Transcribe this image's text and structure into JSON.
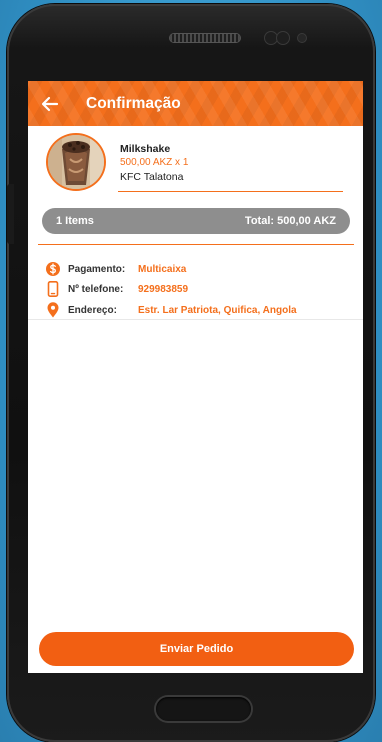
{
  "appbar": {
    "title": "Confirmação"
  },
  "product": {
    "name": "Milkshake",
    "price_qty": "500,00 AKZ x 1",
    "store": "KFC Talatona"
  },
  "summary": {
    "items": "1 Items",
    "total": "Total: 500,00 AKZ"
  },
  "info": {
    "payment_label": "Pagamento:",
    "payment_value": "Multicaixa",
    "phone_label": "Nº telefone:",
    "phone_value": "929983859",
    "address_label": "Endereço:",
    "address_value": "Estr. Lar Patriota, Quifica, Angola"
  },
  "actions": {
    "submit_label": "Enviar Pedido"
  },
  "colors": {
    "accent": "#f46f1c",
    "summary_bg": "#8e8e8e"
  },
  "icons": {
    "back": "arrow-left-icon",
    "payment": "dollar-circle-icon",
    "phone": "mobile-phone-icon",
    "address": "location-pin-icon"
  }
}
